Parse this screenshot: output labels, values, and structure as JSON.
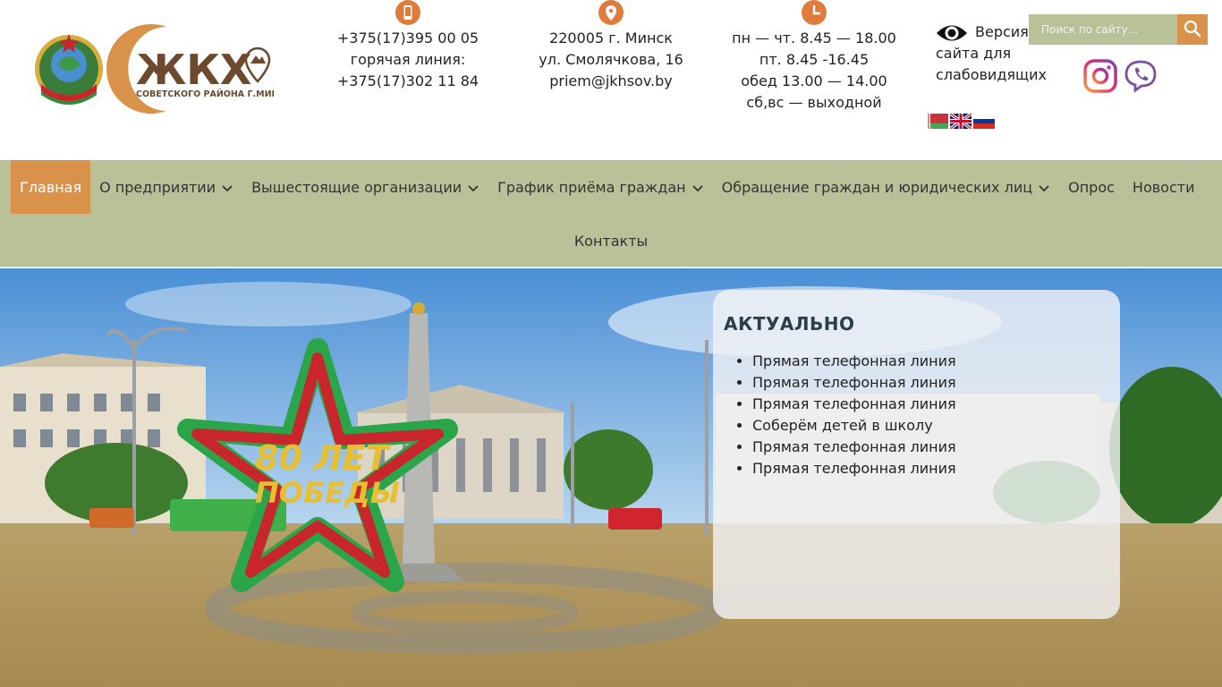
{
  "header": {
    "logo_text": "ЖКХ",
    "logo_subtitle": "СОВЕТСКОГО РАЙОНА Г.МИНСКА",
    "phone": {
      "line1": "+375(17)395 00 05",
      "line2": "горячая линия:",
      "line3": "+375(17)302 11 84"
    },
    "address": {
      "line1": "220005 г. Минск",
      "line2": "ул. Смолячкова, 16",
      "line3": "priem@jkhsov.by"
    },
    "hours": {
      "line1": "пн — чт. 8.45 — 18.00",
      "line2": "пт. 8.45 -16.45",
      "line3": "обед 13.00 — 14.00",
      "line4": "сб,вс — выходной"
    },
    "vision": {
      "line1": "Версия",
      "line2": "сайта для",
      "line3": "слабовидящих"
    },
    "search": {
      "placeholder": "Поиск по сайту..."
    }
  },
  "nav": {
    "items": [
      {
        "label": "Главная"
      },
      {
        "label": "О предприятии"
      },
      {
        "label": "Вышестоящие организации"
      },
      {
        "label": "График приёма граждан"
      },
      {
        "label": "Обращение граждан и юридических лиц"
      },
      {
        "label": "Опрос"
      },
      {
        "label": "Новости"
      },
      {
        "label": "Контакты"
      }
    ]
  },
  "hero": {
    "emblem_line1": "80 ЛЕТ",
    "emblem_line2": "ПОБЕДЫ"
  },
  "news": {
    "title": "АКТУАЛЬНО",
    "items": [
      "Прямая телефонная линия",
      "Прямая телефонная линия",
      "Прямая телефонная линия",
      "Соберём детей в школу",
      "Прямая телефонная линия",
      "Прямая телефонная линия"
    ]
  },
  "colors": {
    "accent_orange": "#d9924a",
    "nav_green": "#b9c198",
    "icon_orange": "#e07b3e"
  }
}
